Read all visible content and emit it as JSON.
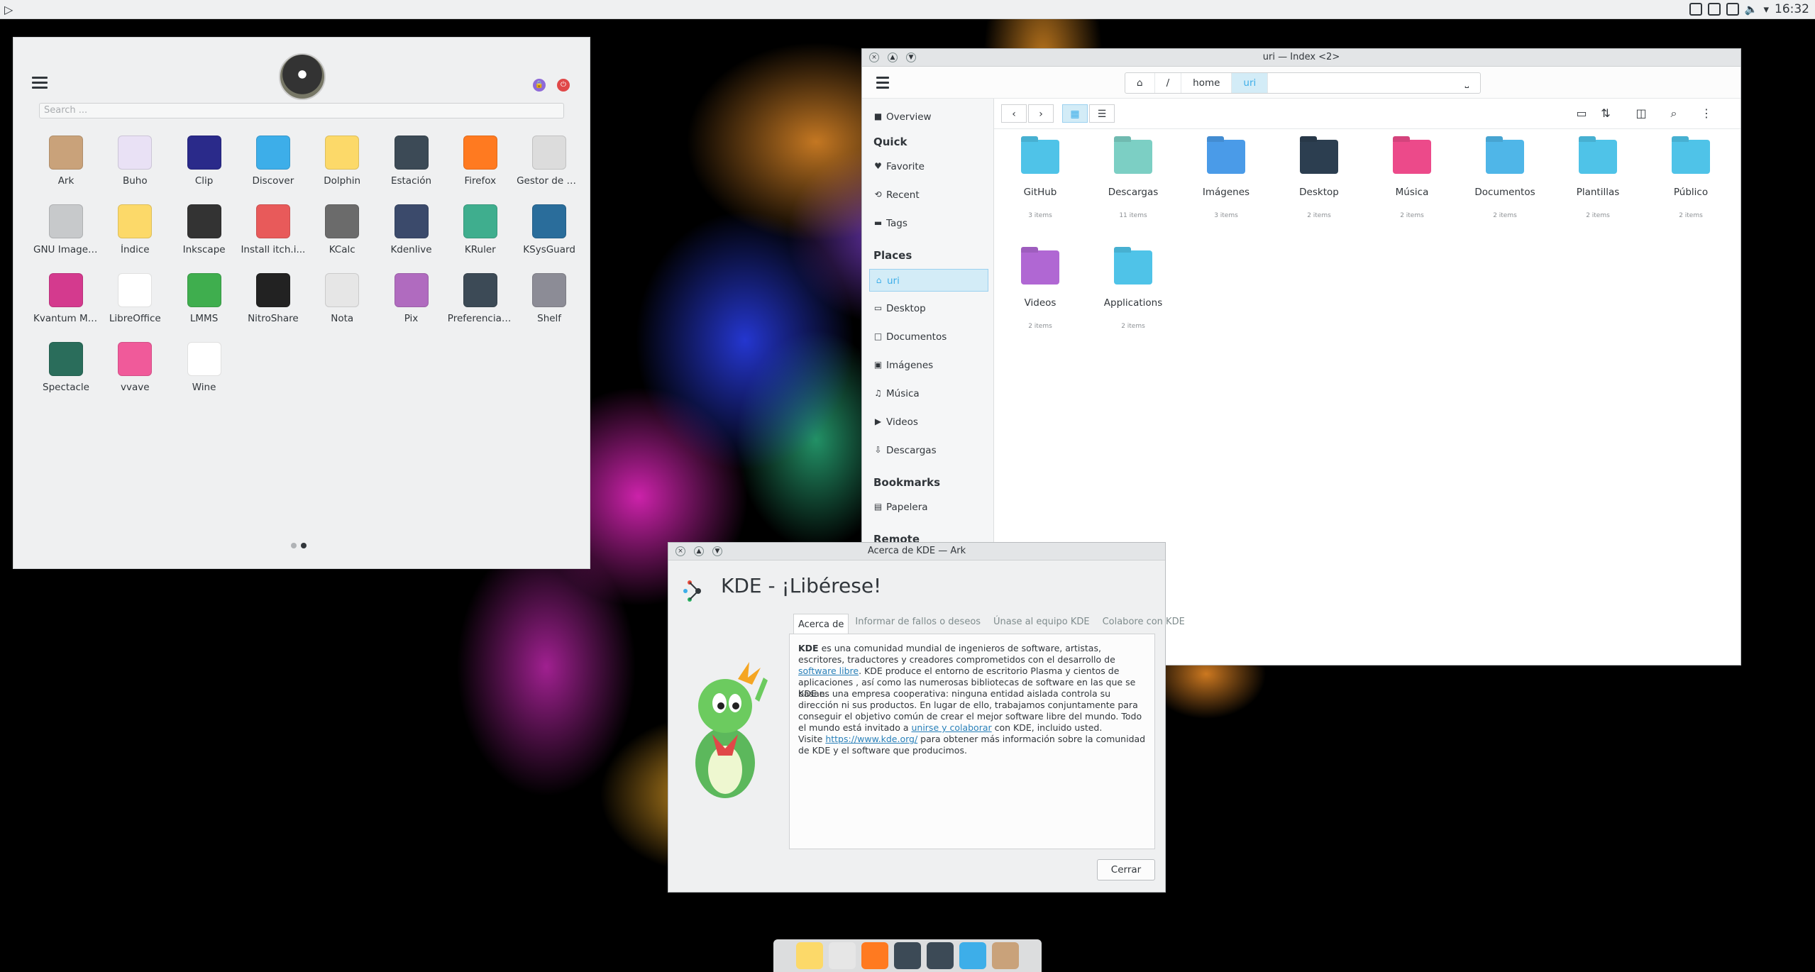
{
  "panel": {
    "clock": "16:32"
  },
  "launcher": {
    "search_placeholder": "Search ...",
    "apps": [
      {
        "label": "Ark",
        "color": "#c9a27a"
      },
      {
        "label": "Buho",
        "color": "#e9e1f5"
      },
      {
        "label": "Clip",
        "color": "#2a2a8a"
      },
      {
        "label": "Discover",
        "color": "#3daee9"
      },
      {
        "label": "Dolphin",
        "color": "#fcd969"
      },
      {
        "label": "Estación",
        "color": "#3c4a56"
      },
      {
        "label": "Firefox",
        "color": "#ff7a20"
      },
      {
        "label": "Gestor de pa...",
        "color": "#dcdcdc"
      },
      {
        "label": "GNU Image ...",
        "color": "#c7c9cb"
      },
      {
        "label": "Índice",
        "color": "#fcd969"
      },
      {
        "label": "Inkscape",
        "color": "#333333"
      },
      {
        "label": "Install itch.i...",
        "color": "#e85a5a"
      },
      {
        "label": "KCalc",
        "color": "#6b6b6b"
      },
      {
        "label": "Kdenlive",
        "color": "#3b4a6b"
      },
      {
        "label": "KRuler",
        "color": "#3fae8e"
      },
      {
        "label": "KSysGuard",
        "color": "#2a6d9b"
      },
      {
        "label": "Kvantum Ma...",
        "color": "#d43a8e"
      },
      {
        "label": "LibreOffice",
        "color": "#ffffff"
      },
      {
        "label": "LMMS",
        "color": "#3fae4e"
      },
      {
        "label": "NitroShare",
        "color": "#222222"
      },
      {
        "label": "Nota",
        "color": "#e6e6e6"
      },
      {
        "label": "Pix",
        "color": "#b06bbf"
      },
      {
        "label": "Preferencias...",
        "color": "#3c4a56"
      },
      {
        "label": "Shelf",
        "color": "#8c8c96"
      },
      {
        "label": "Spectacle",
        "color": "#2a6d5b"
      },
      {
        "label": "vvave",
        "color": "#f05a9a"
      },
      {
        "label": "Wine",
        "color": "#ffffff"
      }
    ]
  },
  "fm": {
    "title": "uri — Index <2>",
    "crumbs": [
      "/",
      "home",
      "uri"
    ],
    "sidebar": {
      "overview": "Overview",
      "quick_header": "Quick",
      "quick": [
        "Favorite",
        "Recent",
        "Tags"
      ],
      "places_header": "Places",
      "places": [
        "uri",
        "Desktop",
        "Documentos",
        "Imágenes",
        "Música",
        "Videos",
        "Descargas"
      ],
      "bookmarks_header": "Bookmarks",
      "bookmarks": [
        "Papelera"
      ],
      "remote_header": "Remote"
    },
    "files": [
      {
        "name": "GitHub",
        "count": "3 items",
        "color": "#4fc3e8"
      },
      {
        "name": "Descargas",
        "count": "11 items",
        "color": "#7ccfc4"
      },
      {
        "name": "Imágenes",
        "count": "3 items",
        "color": "#4a9be8"
      },
      {
        "name": "Desktop",
        "count": "2 items",
        "color": "#2c3e50"
      },
      {
        "name": "Música",
        "count": "2 items",
        "color": "#ec4a8a"
      },
      {
        "name": "Documentos",
        "count": "2 items",
        "color": "#4fb6e8"
      },
      {
        "name": "Plantillas",
        "count": "2 items",
        "color": "#4fc3e8"
      },
      {
        "name": "Público",
        "count": "2 items",
        "color": "#4fc3e8"
      },
      {
        "name": "Videos",
        "count": "2 items",
        "color": "#b067d3"
      },
      {
        "name": "Applications",
        "count": "2 items",
        "color": "#4fc3e8"
      }
    ]
  },
  "about": {
    "title": "Acerca de KDE — Ark",
    "heading": "KDE - ¡Libérese!",
    "tabs": [
      "Acerca de",
      "Informar de fallos o deseos",
      "Únase al equipo KDE",
      "Colabore con KDE"
    ],
    "p1_bold": "KDE",
    "p1_a": " es una comunidad mundial de ingenieros de software, artistas, escritores, traductores y creadores comprometidos con el desarrollo de ",
    "p1_link": "software libre",
    "p1_b": ". KDE produce el entorno de escritorio Plasma y cientos de aplicaciones , así como las numerosas bibliotecas de software en las que se basan.",
    "p2_a": "KDE es una empresa cooperativa: ninguna entidad aislada controla su dirección ni sus productos. En lugar de ello, trabajamos conjuntamente para conseguir el objetivo común de crear el mejor software libre del mundo. Todo el mundo está invitado a ",
    "p2_link": "unirse y colaborar",
    "p2_b": " con KDE, incluido usted.",
    "p3_a": "Visite ",
    "p3_link": "https://www.kde.org/",
    "p3_b": " para obtener más información sobre la comunidad de KDE y el software que producimos.",
    "close": "Cerrar"
  },
  "dock": [
    "#fcd969",
    "#e6e6e6",
    "#ff7a20",
    "#3c4a56",
    "#3c4a56",
    "#3daee9",
    "#c9a27a"
  ]
}
